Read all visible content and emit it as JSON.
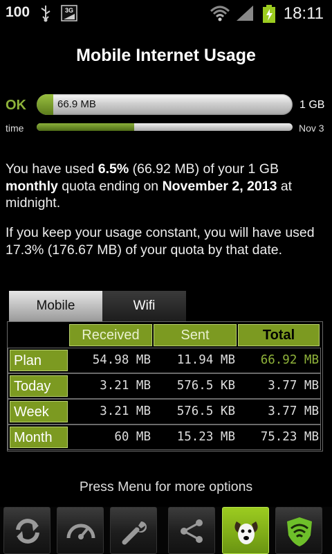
{
  "status_bar": {
    "battery_level": "100",
    "network_label": "3G",
    "time": "18:11"
  },
  "title": "Mobile Internet Usage",
  "data_bar": {
    "status": "OK",
    "used_label": "66.9 MB",
    "max_label": "1 GB",
    "fill_fraction": 0.065
  },
  "time_bar": {
    "label": "time",
    "end_label": "Nov 3",
    "fill_fraction": 0.38
  },
  "summary": {
    "p1": {
      "t1": "You have used ",
      "pct": "6.5%",
      "t2": " (66.92 MB) of your 1 GB ",
      "period": "monthly",
      "t3": " quota ending on ",
      "date": "November 2, 2013",
      "t4": " at midnight."
    },
    "p2": "If you keep your usage constant, you will have used 17.3% (176.67 MB) of your quota by that date."
  },
  "tabs": [
    "Mobile",
    "Wifi"
  ],
  "table": {
    "headers": [
      "Received",
      "Sent",
      "Total"
    ],
    "rows": [
      {
        "label": "Plan",
        "received": "54.98 MB",
        "sent": "11.94 MB",
        "total": "66.92 MB"
      },
      {
        "label": "Today",
        "received": "3.21 MB",
        "sent": "576.5 KB",
        "total": "3.77 MB"
      },
      {
        "label": "Week",
        "received": "3.21 MB",
        "sent": "576.5 KB",
        "total": "3.77 MB"
      },
      {
        "label": "Month",
        "received": "60 MB",
        "sent": "15.23 MB",
        "total": "75.23 MB"
      }
    ]
  },
  "hint": "Press Menu for more options",
  "bottom_buttons": [
    "refresh-icon",
    "speedometer-icon",
    "wrench-icon",
    "share-icon",
    "dog-mascot-icon",
    "wifi-shield-icon"
  ],
  "colors": {
    "accent_green": "#8fb33a",
    "header_green": "#7c9a21"
  }
}
